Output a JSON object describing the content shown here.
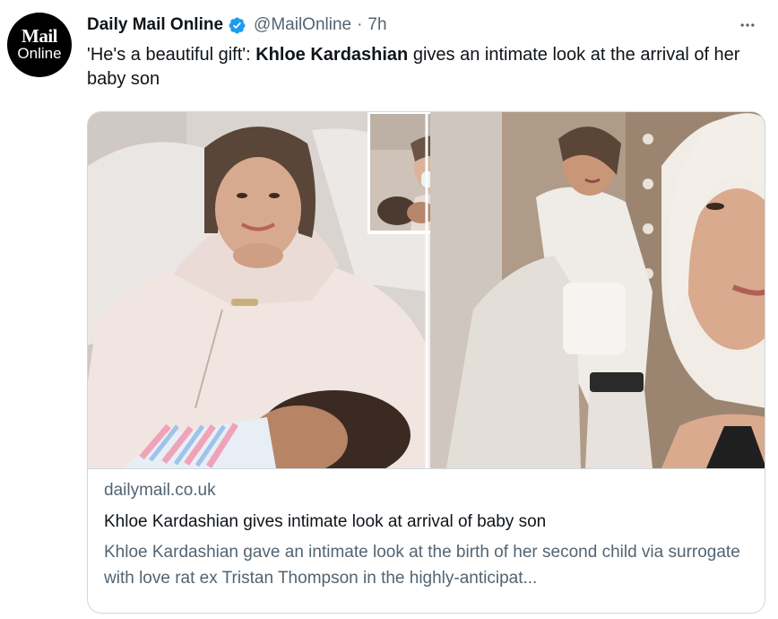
{
  "account": {
    "avatar_line1": "Mail",
    "avatar_line2": "Online",
    "name": "Daily Mail Online",
    "handle": "@MailOnline",
    "separator": "·",
    "time": "7h"
  },
  "tweet": {
    "text_part1": "'He's a beautiful gift': ",
    "text_bold": "Khloe Kardashian",
    "text_part2": " gives an intimate look at the arrival of her baby son"
  },
  "card": {
    "domain": "dailymail.co.uk",
    "title": "Khloe Kardashian gives intimate look at arrival of baby son",
    "description": "Khloe Kardashian gave an intimate look at the birth of her second child via surrogate with love rat ex Tristan Thompson in the highly-anticipat..."
  },
  "icons": {
    "more": "more-icon",
    "verified": "verified-badge-icon"
  },
  "colors": {
    "text_primary": "#0f1419",
    "text_secondary": "#536471",
    "verified_blue": "#1d9bf0",
    "border": "#cfd9de"
  }
}
